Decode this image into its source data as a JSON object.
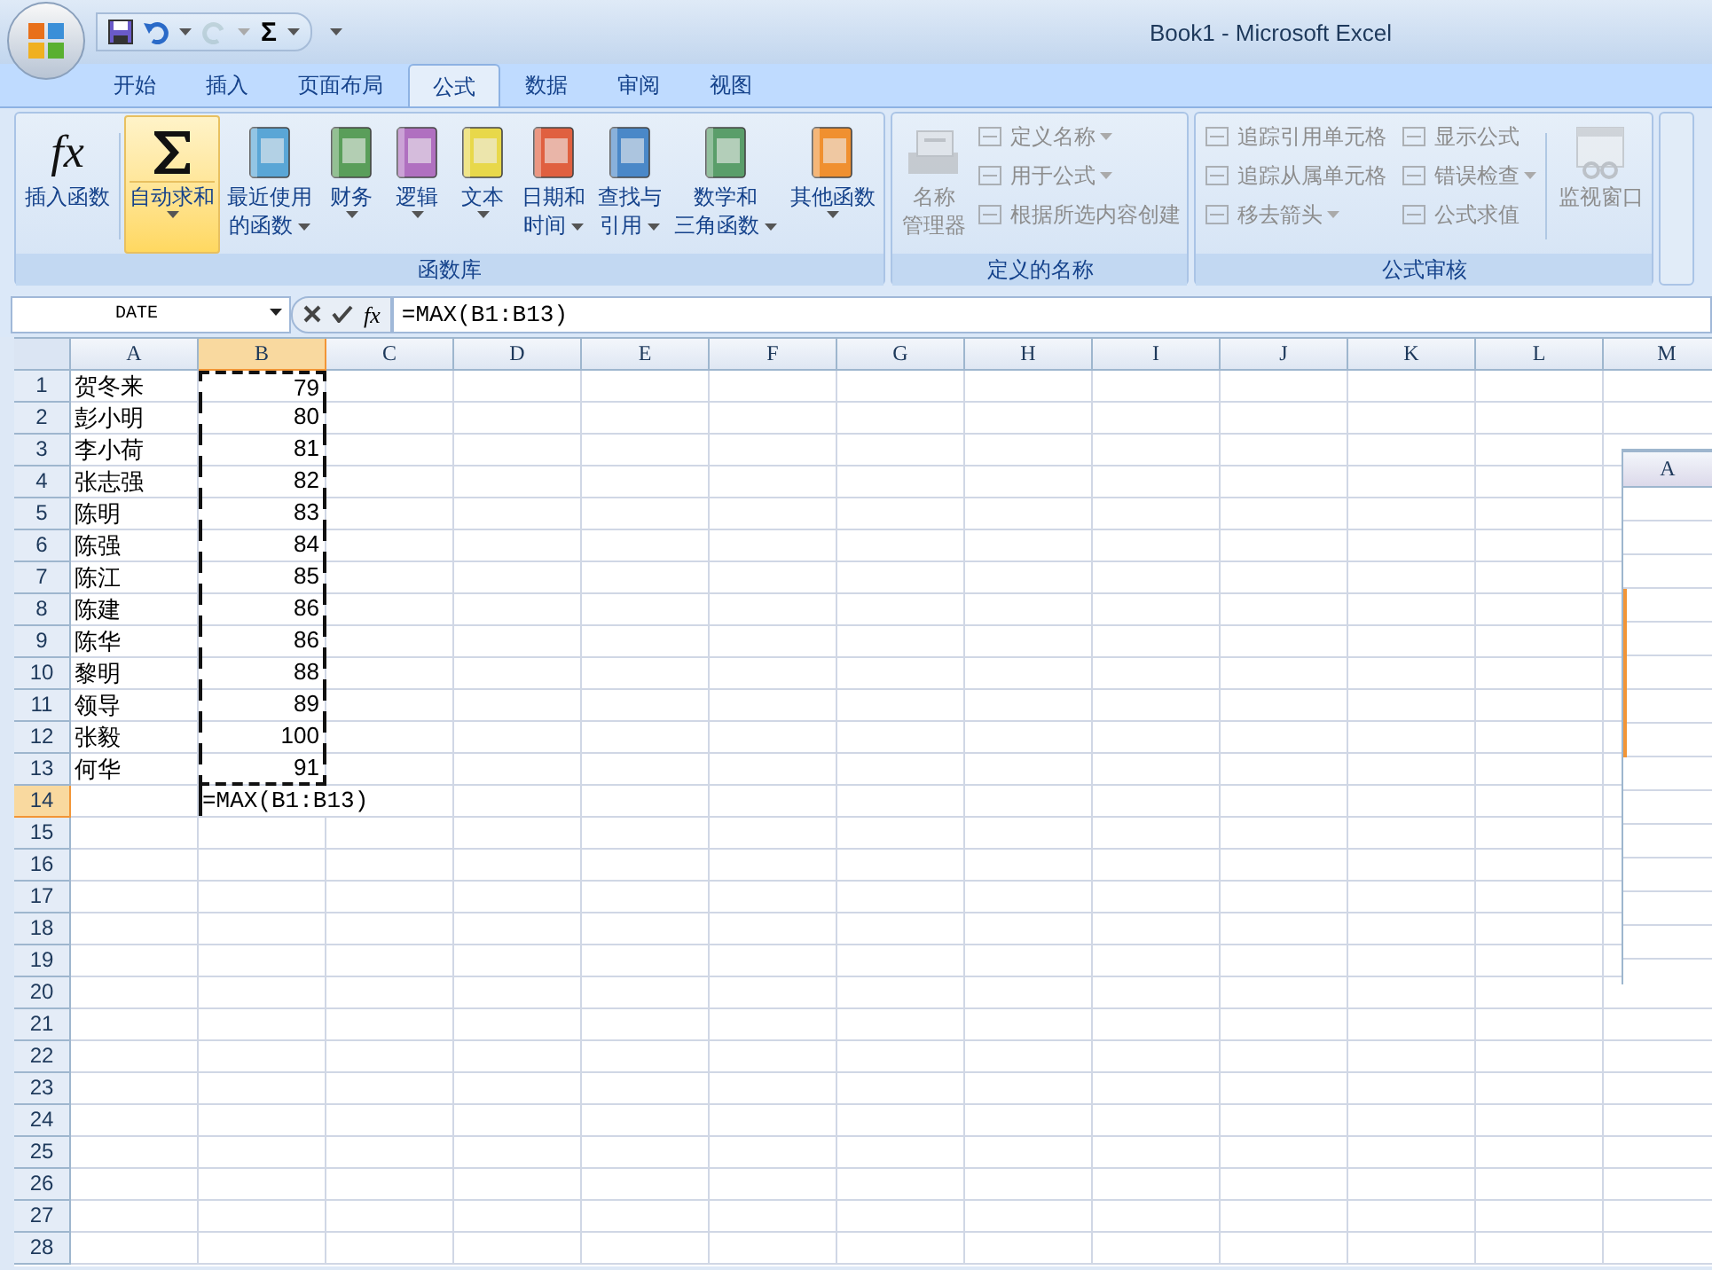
{
  "window": {
    "title": "Book1 - Microsoft Excel"
  },
  "quick_access": {
    "sum_label": "Σ",
    "redo_disabled": true
  },
  "tabs": [
    {
      "label": "开始",
      "selected": false
    },
    {
      "label": "插入",
      "selected": false
    },
    {
      "label": "页面布局",
      "selected": false
    },
    {
      "label": "公式",
      "selected": true
    },
    {
      "label": "数据",
      "selected": false
    },
    {
      "label": "审阅",
      "selected": false
    },
    {
      "label": "视图",
      "selected": false
    }
  ],
  "ribbon": {
    "groups": [
      {
        "label": "函数库",
        "large": [
          {
            "lines": [
              "插入函数"
            ],
            "icon_label": "fx",
            "dropdown": false,
            "active": false,
            "disabled": false
          },
          {
            "lines": [
              "自动求和"
            ],
            "dropdown": true,
            "active": true,
            "disabled": false
          },
          {
            "lines": [
              "最近使用",
              "的函数"
            ],
            "dropdown": true,
            "active": false,
            "disabled": false
          },
          {
            "lines": [
              "财务"
            ],
            "dropdown": true,
            "active": false,
            "disabled": false
          },
          {
            "lines": [
              "逻辑"
            ],
            "dropdown": true,
            "active": false,
            "disabled": false
          },
          {
            "lines": [
              "文本"
            ],
            "dropdown": true,
            "active": false,
            "disabled": false
          },
          {
            "lines": [
              "日期和",
              "时间"
            ],
            "dropdown": true,
            "active": false,
            "disabled": false
          },
          {
            "lines": [
              "查找与",
              "引用"
            ],
            "dropdown": true,
            "active": false,
            "disabled": false
          },
          {
            "lines": [
              "数学和",
              "三角函数"
            ],
            "dropdown": true,
            "active": false,
            "disabled": false
          },
          {
            "lines": [
              "其他函数"
            ],
            "dropdown": true,
            "active": false,
            "disabled": false
          }
        ]
      },
      {
        "label": "定义的名称",
        "large": [
          {
            "lines": [
              "名称",
              "管理器"
            ],
            "dropdown": false,
            "active": false,
            "disabled": true
          }
        ],
        "small": [
          {
            "label": "定义名称",
            "dropdown": true,
            "disabled": true
          },
          {
            "label": "用于公式",
            "dropdown": true,
            "disabled": true
          },
          {
            "label": "根据所选内容创建",
            "dropdown": false,
            "disabled": true
          }
        ]
      },
      {
        "label": "公式审核",
        "small": [
          {
            "label": "追踪引用单元格",
            "dropdown": false,
            "disabled": true
          },
          {
            "label": "追踪从属单元格",
            "dropdown": false,
            "disabled": true
          },
          {
            "label": "移去箭头",
            "dropdown": true,
            "disabled": true
          },
          {
            "label": "显示公式",
            "dropdown": false,
            "disabled": true
          },
          {
            "label": "错误检查",
            "dropdown": true,
            "disabled": true
          },
          {
            "label": "公式求值",
            "dropdown": false,
            "disabled": true
          }
        ],
        "after": [
          {
            "lines": [
              "监视窗口"
            ],
            "dropdown": false,
            "active": false,
            "disabled": true
          }
        ]
      }
    ]
  },
  "formula_bar": {
    "name_box": "DATE",
    "fx_label": "fx",
    "formula": "=MAX(B1:B13)"
  },
  "sheet": {
    "columns": [
      {
        "label": "A",
        "selected": false
      },
      {
        "label": "B",
        "selected": true
      },
      {
        "label": "C",
        "selected": false
      },
      {
        "label": "D",
        "selected": false
      },
      {
        "label": "E",
        "selected": false
      },
      {
        "label": "F",
        "selected": false
      },
      {
        "label": "G",
        "selected": false
      },
      {
        "label": "H",
        "selected": false
      },
      {
        "label": "I",
        "selected": false
      },
      {
        "label": "J",
        "selected": false
      },
      {
        "label": "K",
        "selected": false
      },
      {
        "label": "L",
        "selected": false
      },
      {
        "label": "M",
        "selected": false
      }
    ],
    "rows": [
      {
        "number": "1",
        "selected": false,
        "a": "贺冬来",
        "b": "79",
        "in_copy_range": true,
        "editing": false
      },
      {
        "number": "2",
        "selected": false,
        "a": "彭小明",
        "b": "80",
        "in_copy_range": true,
        "editing": false
      },
      {
        "number": "3",
        "selected": false,
        "a": "李小荷",
        "b": "81",
        "in_copy_range": true,
        "editing": false
      },
      {
        "number": "4",
        "selected": false,
        "a": "张志强",
        "b": "82",
        "in_copy_range": true,
        "editing": false
      },
      {
        "number": "5",
        "selected": false,
        "a": "陈明",
        "b": "83",
        "in_copy_range": true,
        "editing": false
      },
      {
        "number": "6",
        "selected": false,
        "a": "陈强",
        "b": "84",
        "in_copy_range": true,
        "editing": false
      },
      {
        "number": "7",
        "selected": false,
        "a": "陈江",
        "b": "85",
        "in_copy_range": true,
        "editing": false
      },
      {
        "number": "8",
        "selected": false,
        "a": "陈建",
        "b": "86",
        "in_copy_range": true,
        "editing": false
      },
      {
        "number": "9",
        "selected": false,
        "a": "陈华",
        "b": "86",
        "in_copy_range": true,
        "editing": false
      },
      {
        "number": "10",
        "selected": false,
        "a": "黎明",
        "b": "88",
        "in_copy_range": true,
        "editing": false
      },
      {
        "number": "11",
        "selected": false,
        "a": "领导",
        "b": "89",
        "in_copy_range": true,
        "editing": false
      },
      {
        "number": "12",
        "selected": false,
        "a": "张毅",
        "b": "100",
        "in_copy_range": true,
        "editing": false
      },
      {
        "number": "13",
        "selected": false,
        "a": "何华",
        "b": "91",
        "in_copy_range": true,
        "editing": false
      },
      {
        "number": "14",
        "selected": true,
        "b": "=MAX(B1:B13)",
        "in_copy_range": false,
        "editing": true
      },
      {
        "number": "15",
        "selected": false
      },
      {
        "number": "16",
        "selected": false
      },
      {
        "number": "17",
        "selected": false
      },
      {
        "number": "18",
        "selected": false
      },
      {
        "number": "19",
        "selected": false
      },
      {
        "number": "20",
        "selected": false
      },
      {
        "number": "21",
        "selected": false
      },
      {
        "number": "22",
        "selected": false
      },
      {
        "number": "23",
        "selected": false
      },
      {
        "number": "24",
        "selected": false
      },
      {
        "number": "25",
        "selected": false
      },
      {
        "number": "26",
        "selected": false
      },
      {
        "number": "27",
        "selected": false
      },
      {
        "number": "28",
        "selected": false
      }
    ]
  },
  "floating_pane": {
    "columns": [
      {
        "label": "A"
      }
    ]
  }
}
